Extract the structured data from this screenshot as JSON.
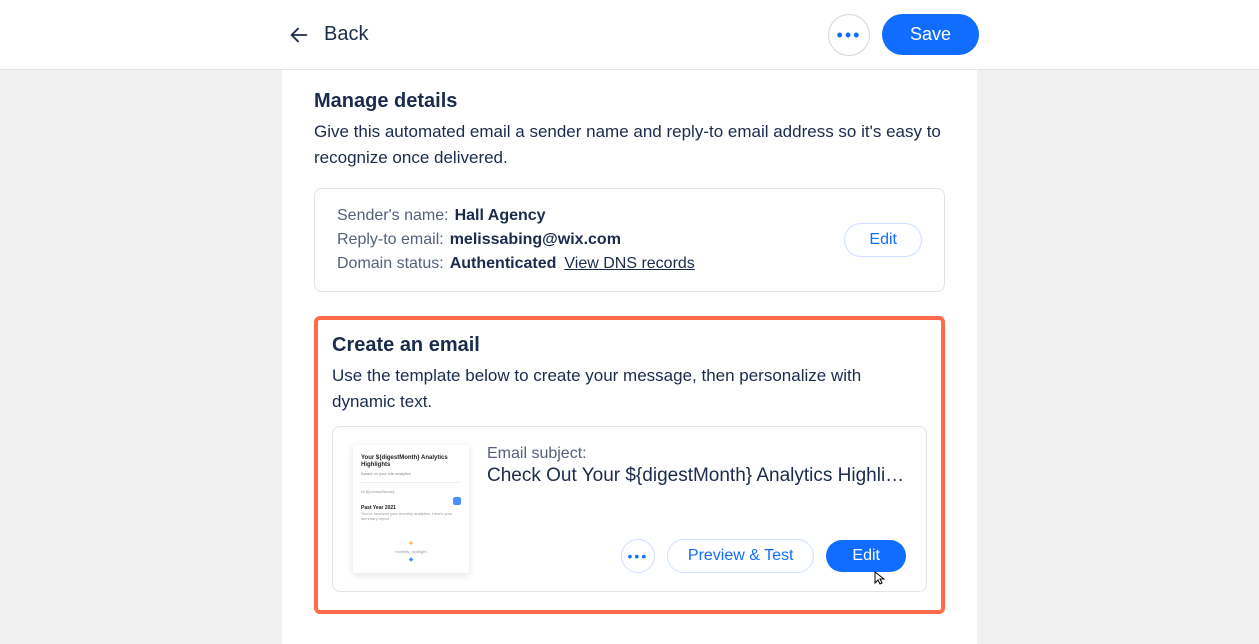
{
  "topbar": {
    "back_label": "Back",
    "save_label": "Save"
  },
  "manage": {
    "title": "Manage details",
    "description": "Give this automated email a sender name and reply-to email address so it's easy to recognize once delivered.",
    "sender_label": "Sender's name:",
    "sender_value": "Hall Agency",
    "reply_label": "Reply-to email:",
    "reply_value": "melissabing@wix.com",
    "domain_label": "Domain status:",
    "domain_value": "Authenticated",
    "dns_link": "View DNS records",
    "edit_label": "Edit"
  },
  "create": {
    "title": "Create an email",
    "description": "Use the template below to create your message, then personalize with dynamic text.",
    "subject_label": "Email subject:",
    "subject_value": "Check Out Your ${digestMonth} Analytics Highli…",
    "preview_label": "Preview & Test",
    "edit_label": "Edit",
    "thumbnail": {
      "title": "Your ${digestMonth} Analytics Highlights",
      "sub1": "Based on your site analytics",
      "greeting": "Hi ${contactName},",
      "section_title": "Past Year 2021",
      "body_line": "You've received your monthly analytics. Here's your summary report.",
      "footer_name": "monthly_spotlight"
    }
  }
}
